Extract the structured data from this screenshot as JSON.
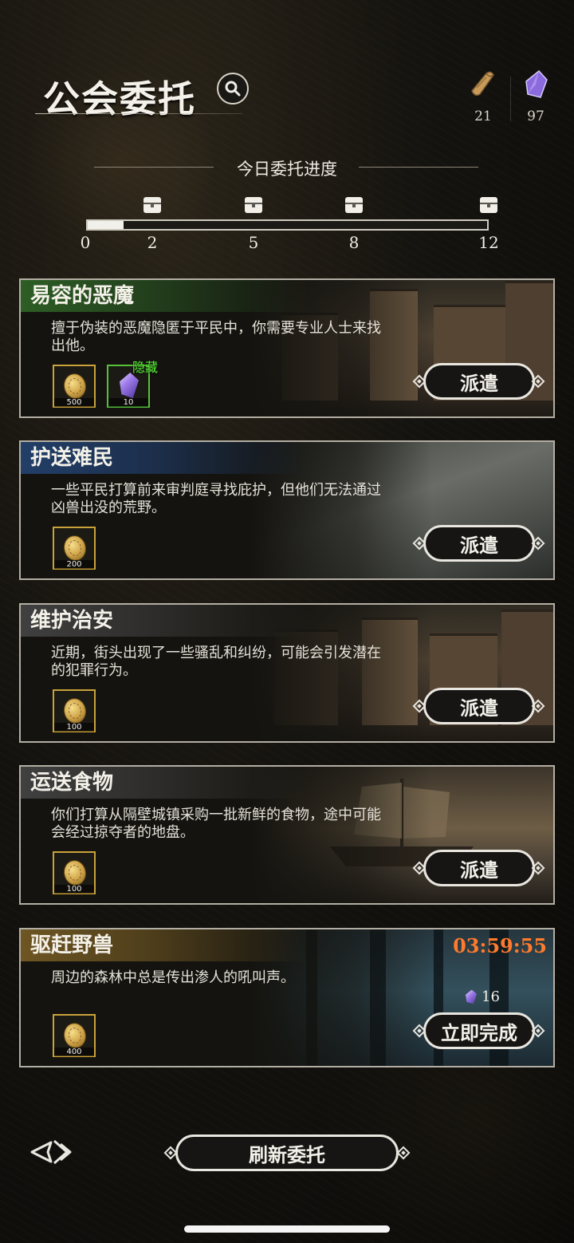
{
  "header": {
    "title": "公会委托",
    "currency": [
      {
        "icon": "scroll-icon",
        "value": "21"
      },
      {
        "icon": "purple-gem-icon",
        "value": "97"
      }
    ]
  },
  "progress": {
    "title": "今日委托进度",
    "current": 1,
    "max": 12,
    "fill_fraction": 0.09,
    "milestones": [
      "0",
      "2",
      "5",
      "8",
      "12"
    ]
  },
  "commissions": [
    {
      "title": "易容的恶魔",
      "description": "擅于伪装的恶魔隐匿于平民中，你需要专业人士来找出他。",
      "rewards": [
        {
          "icon": "gold-coin-icon",
          "count": "500"
        },
        {
          "icon": "purple-gem-icon",
          "count": "10",
          "tag": "隐藏"
        }
      ],
      "button": "派遣"
    },
    {
      "title": "护送难民",
      "description": "一些平民打算前来审判庭寻找庇护，但他们无法通过凶兽出没的荒野。",
      "rewards": [
        {
          "icon": "gold-coin-icon",
          "count": "200"
        }
      ],
      "button": "派遣"
    },
    {
      "title": "维护治安",
      "description": "近期，街头出现了一些骚乱和纠纷，可能会引发潜在的犯罪行为。",
      "rewards": [
        {
          "icon": "gold-coin-icon",
          "count": "100"
        }
      ],
      "button": "派遣"
    },
    {
      "title": "运送食物",
      "description": "你们打算从隔壁城镇采购一批新鲜的食物，途中可能会经过掠夺者的地盘。",
      "rewards": [
        {
          "icon": "gold-coin-icon",
          "count": "100"
        }
      ],
      "button": "派遣"
    },
    {
      "title": "驱赶野兽",
      "description": "周边的森林中总是传出渗人的吼叫声。",
      "rewards": [
        {
          "icon": "gold-coin-icon",
          "count": "400"
        }
      ],
      "timer": "03:59:55",
      "cost": "16",
      "button": "立即完成"
    }
  ],
  "footer": {
    "refresh_label": "刷新委托"
  },
  "colors": {
    "accent_orange": "#ff7a2c",
    "hidden_green": "#5cf23a"
  }
}
